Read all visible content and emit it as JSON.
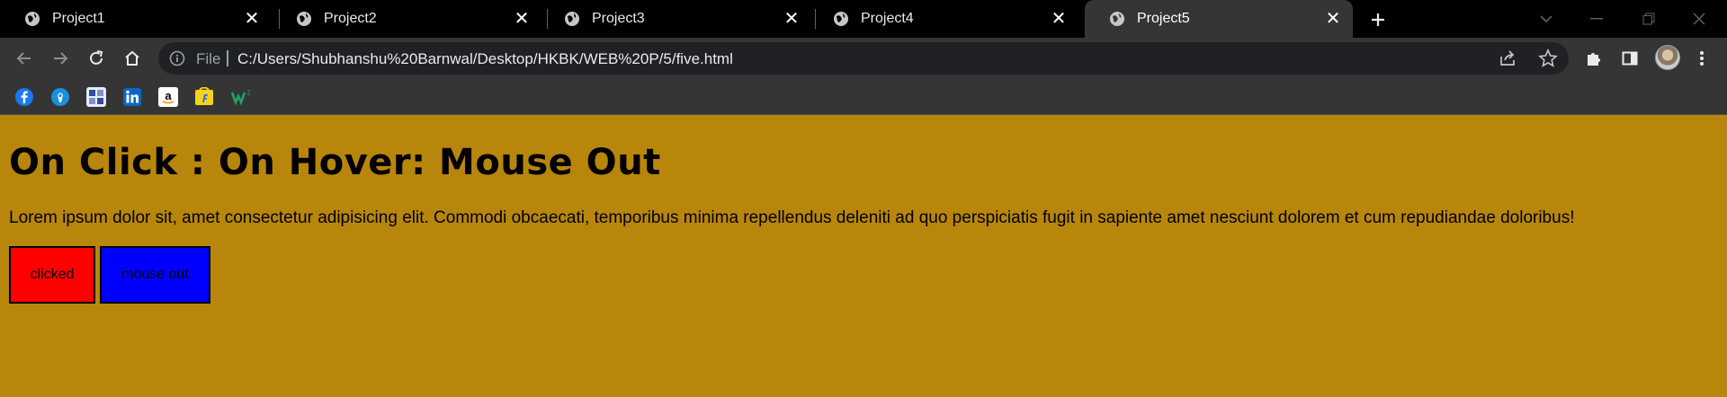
{
  "tabs": [
    {
      "title": "Project1",
      "active": false
    },
    {
      "title": "Project2",
      "active": false
    },
    {
      "title": "Project3",
      "active": false
    },
    {
      "title": "Project4",
      "active": false
    },
    {
      "title": "Project5",
      "active": true
    }
  ],
  "tab_close_glyph": "✕",
  "toolbar": {
    "back_icon": "arrow-left-icon",
    "forward_icon": "arrow-right-icon",
    "reload_icon": "reload-icon",
    "home_icon": "home-icon"
  },
  "omnibox": {
    "scheme": "File",
    "url": "C:/Users/Shubhanshu%20Barnwal/Desktop/HKBK/WEB%20P/5/five.html"
  },
  "bookmarks": [
    {
      "icon": "facebook-icon",
      "color": "#1877f2"
    },
    {
      "icon": "globe-blue-icon",
      "color": "#1a73e8"
    },
    {
      "icon": "image-icon",
      "color": "#6b8fd6"
    },
    {
      "icon": "linkedin-icon",
      "color": "#0a66c2"
    },
    {
      "icon": "amazon-icon",
      "color": "#ffffff"
    },
    {
      "icon": "flipkart-icon",
      "color": "#f8d21a"
    },
    {
      "icon": "w-logo-icon",
      "color": "#1fa463"
    }
  ],
  "page": {
    "heading": "On Click : On Hover: Mouse Out",
    "paragraph": "Lorem ipsum dolor sit, amet consectetur adipisicing elit. Commodi obcaecati, temporibus minima repellendus deleniti ad quo perspiciatis fugit in sapiente amet nesciunt dolorem et cum repudiandae doloribus!",
    "button1": {
      "label": "clicked",
      "color": "#ff0000"
    },
    "button2": {
      "label": "mouse out",
      "color": "#0000ff"
    },
    "background_color": "#b8860b"
  }
}
